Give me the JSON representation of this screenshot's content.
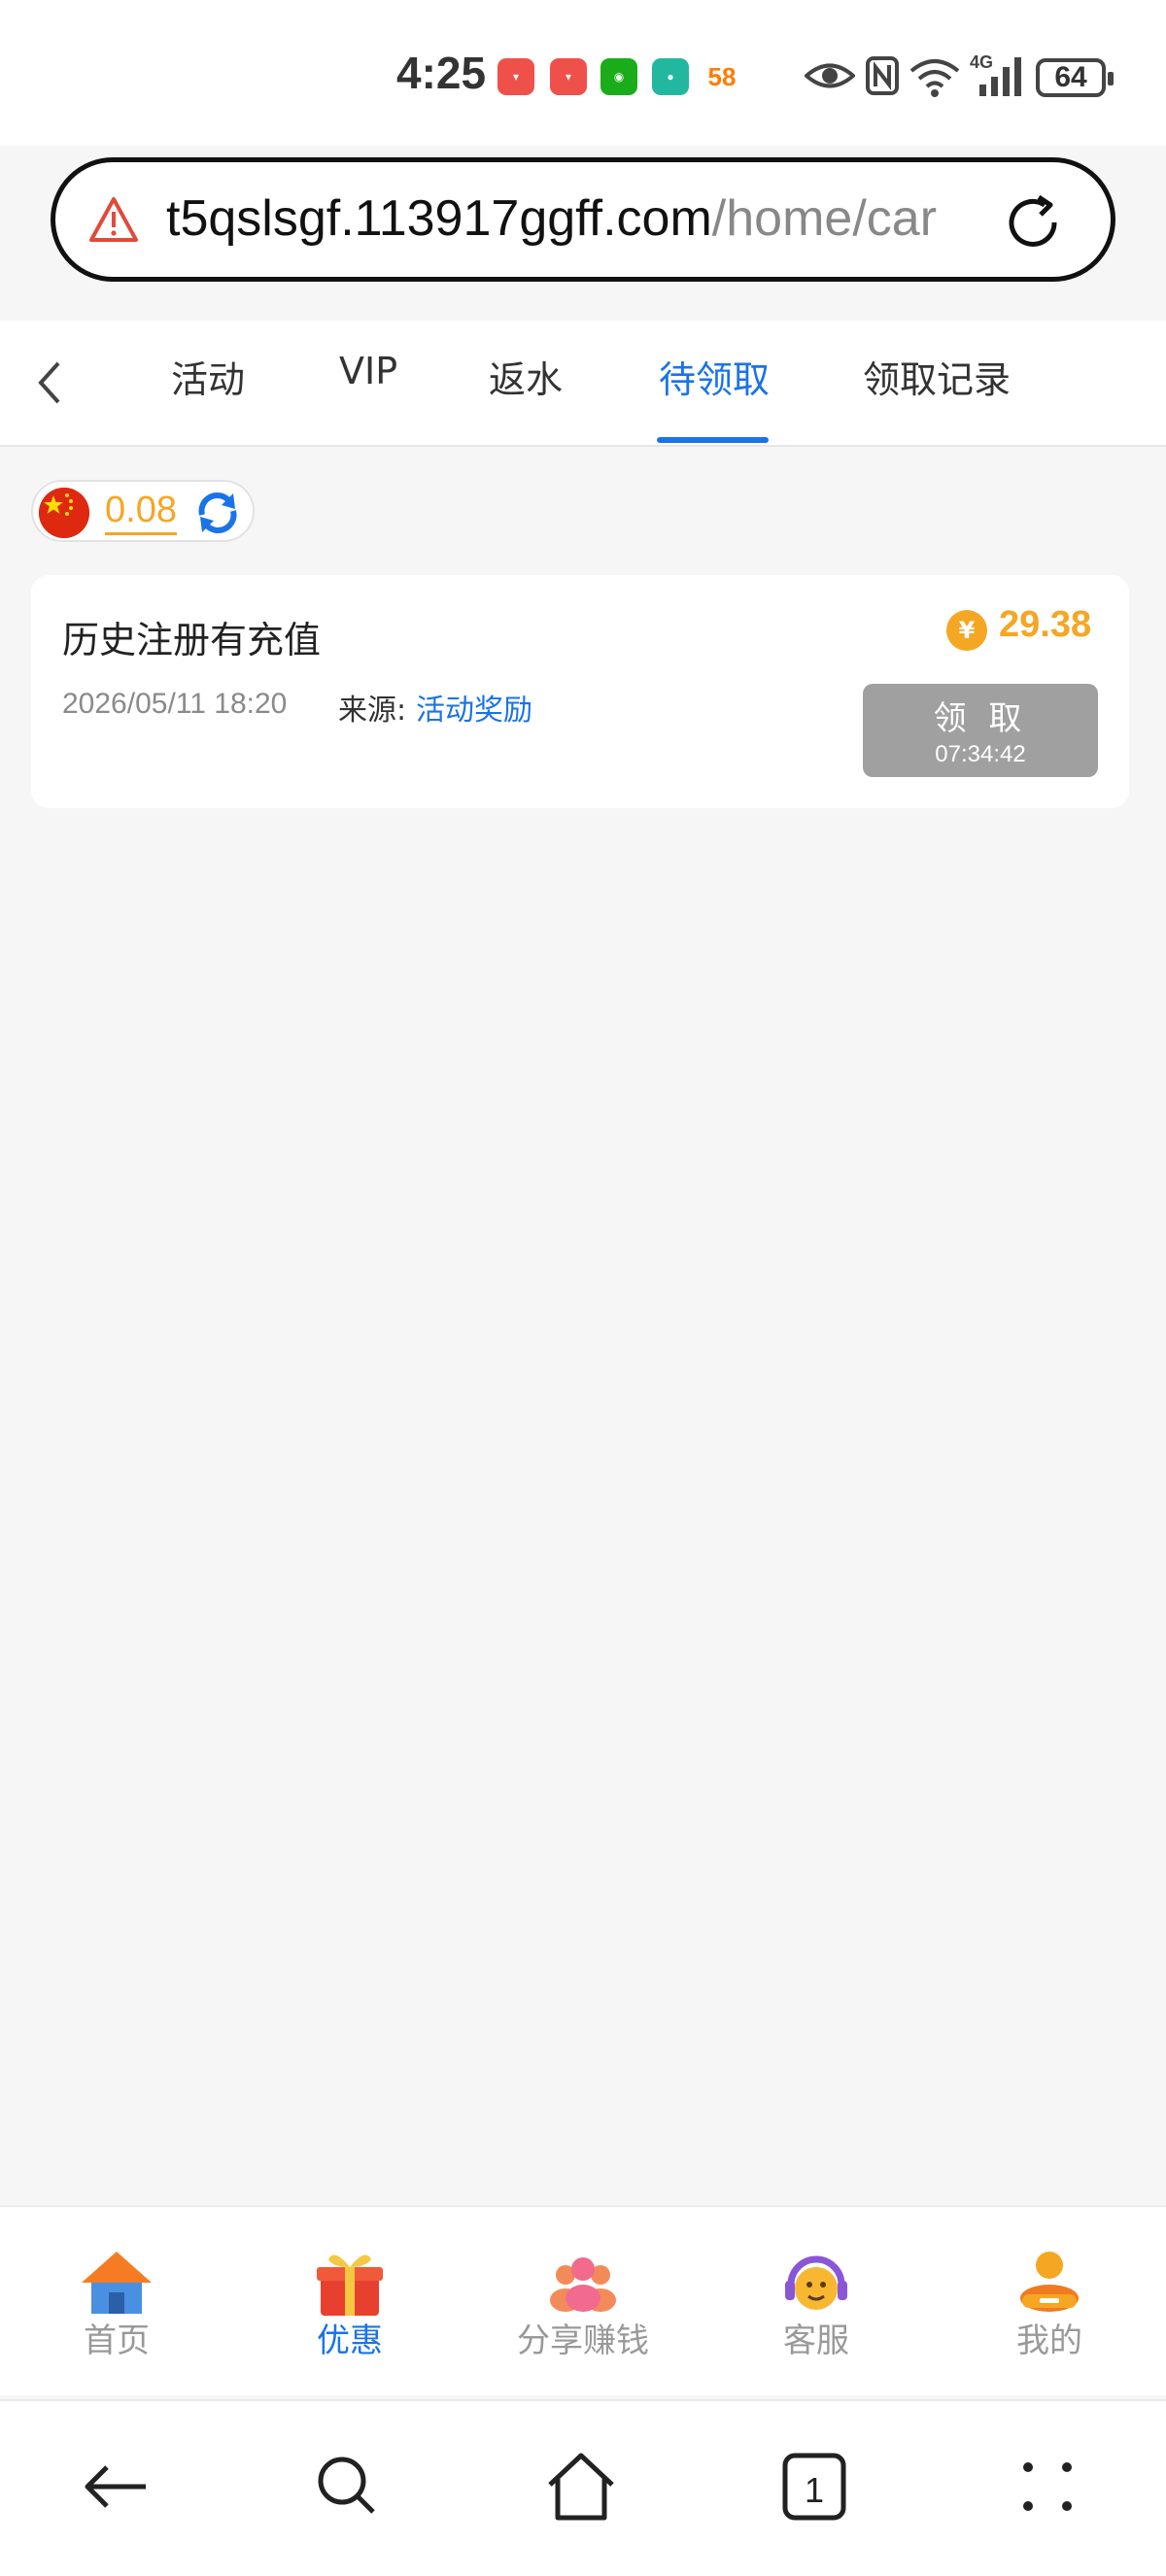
{
  "status_bar": {
    "time": "4:25",
    "app_icons": [
      {
        "name": "meituan-icon",
        "color": "#f0504a"
      },
      {
        "name": "meituan-icon",
        "color": "#f0504a"
      },
      {
        "name": "wechat-icon",
        "color": "#1aad19"
      },
      {
        "name": "app-icon",
        "color": "#22b8a0"
      },
      {
        "name": "58-icon",
        "color": "#ff7d00"
      }
    ],
    "signal_label": "4G",
    "battery": "64"
  },
  "browser": {
    "url_host": "t5qslsgf.113917ggff.com",
    "url_path": "/home/car"
  },
  "tabs": {
    "items": [
      {
        "label": "活动"
      },
      {
        "label": "VIP"
      },
      {
        "label": "返水"
      },
      {
        "label": "待领取"
      },
      {
        "label": "领取记录"
      }
    ],
    "active_index": 3
  },
  "balance": {
    "value": "0.08"
  },
  "reward_card": {
    "title": "历史注册有充值",
    "date": "2026/05/11 18:20",
    "source_label": "来源:",
    "source_value": "活动奖励",
    "amount": "29.38",
    "coin_symbol": "¥",
    "button_label": "领 取",
    "countdown": "07:34:42"
  },
  "bottom_nav": {
    "items": [
      {
        "label": "首页",
        "icon": "home-icon"
      },
      {
        "label": "优惠",
        "icon": "gift-icon"
      },
      {
        "label": "分享赚钱",
        "icon": "share-icon"
      },
      {
        "label": "客服",
        "icon": "support-icon"
      },
      {
        "label": "我的",
        "icon": "profile-icon"
      }
    ],
    "active_index": 1
  },
  "colors": {
    "accent": "#1a73e8",
    "gold": "#f5a623",
    "button_disabled": "#a0a0a0"
  }
}
